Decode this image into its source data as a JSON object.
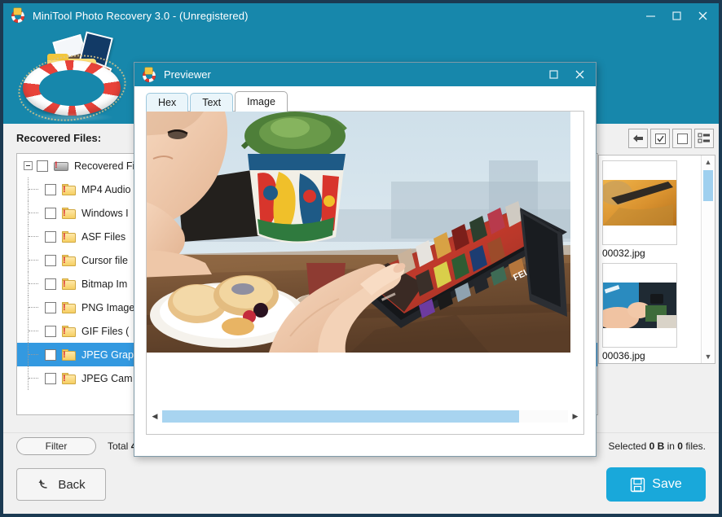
{
  "app": {
    "title": "MiniTool Photo Recovery 3.0 - (Unregistered)",
    "icon": "lifebuoy-icon",
    "accent_color": "#1787ab",
    "frame_color": "#1b3a52",
    "save_color": "#19a8da",
    "window_controls": {
      "minimize": "minimize-icon",
      "maximize": "maximize-icon",
      "close": "close-icon"
    }
  },
  "left_panel": {
    "heading": "Recovered Files:",
    "tree": [
      {
        "label": "Recovered Fil",
        "level": 0,
        "checked": false,
        "selected": false,
        "icon": "camera-warning-icon",
        "expander": "collapse-box"
      },
      {
        "label": "MP4 Audio",
        "level": 1,
        "checked": false,
        "selected": false,
        "icon": "folder-warning-icon"
      },
      {
        "label": "Windows I",
        "level": 1,
        "checked": false,
        "selected": false,
        "icon": "folder-warning-icon"
      },
      {
        "label": "ASF Files",
        "level": 1,
        "checked": false,
        "selected": false,
        "icon": "folder-warning-icon"
      },
      {
        "label": "Cursor file",
        "level": 1,
        "checked": false,
        "selected": false,
        "icon": "folder-warning-icon"
      },
      {
        "label": "Bitmap Im",
        "level": 1,
        "checked": false,
        "selected": false,
        "icon": "folder-warning-icon"
      },
      {
        "label": "PNG Image",
        "level": 1,
        "checked": false,
        "selected": false,
        "icon": "folder-warning-icon"
      },
      {
        "label": "GIF Files (",
        "level": 1,
        "checked": false,
        "selected": false,
        "icon": "folder-warning-icon"
      },
      {
        "label": "JPEG Grap",
        "level": 1,
        "checked": false,
        "selected": true,
        "icon": "folder-warning-icon"
      },
      {
        "label": "JPEG Cam",
        "level": 1,
        "checked": false,
        "selected": false,
        "icon": "folder-warning-icon"
      }
    ]
  },
  "right_panel": {
    "toolbar": [
      {
        "name": "back-button",
        "icon": "arrow-left-icon"
      },
      {
        "name": "select-all-button",
        "icon": "checkbox-checked-icon"
      },
      {
        "name": "deselect-all-button",
        "icon": "checkbox-empty-icon"
      },
      {
        "name": "list-view-button",
        "icon": "list-view-icon"
      }
    ],
    "thumbnails": [
      {
        "filename": "00032.jpg"
      },
      {
        "filename": "00036.jpg"
      },
      {
        "filename": ""
      }
    ],
    "scrollbar": {
      "up_arrow": "scroll-up-icon",
      "down_arrow": "scroll-down-icon"
    }
  },
  "statusbar": {
    "filter_label": "Filter",
    "total_prefix": "Total ",
    "total_value": "4",
    "total_suffix": "",
    "selected_prefix": "Selected ",
    "selected_size": "0 B",
    "selected_middle": " in ",
    "selected_count": "0",
    "selected_suffix": " files."
  },
  "actionbar": {
    "back_label": "Back",
    "back_icon": "undo-arrow-icon",
    "save_label": "Save",
    "save_icon": "floppy-disk-icon"
  },
  "dialog": {
    "title": "Previewer",
    "icon": "lifebuoy-icon",
    "controls": {
      "maximize": "maximize-icon",
      "close": "close-icon"
    },
    "tabs": [
      {
        "label": "Hex",
        "active": false
      },
      {
        "label": "Text",
        "active": false
      },
      {
        "label": "Image",
        "active": true
      }
    ],
    "image_preview": {
      "description": "woman-touching-tablet-photo",
      "alt": "Woman at a cafe table touching a tablet showing a media app with movie posters; plate of pastries and a potted plant nearby"
    },
    "hscrollbar": {
      "left_arrow": "scroll-left-icon",
      "right_arrow": "scroll-right-icon",
      "thumb_percent": 88
    }
  }
}
